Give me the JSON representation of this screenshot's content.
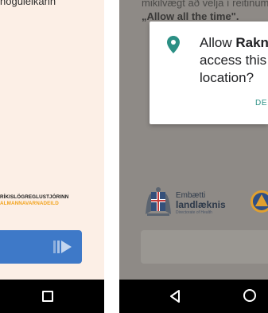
{
  "left_screen": {
    "top_text": "nóguleikann",
    "agency_line1": "RÍKISLÖGREGLUSTJÓRINN",
    "agency_line2": "ALMANNAVARNADEILD",
    "button_icon": "play-skip-icon"
  },
  "right_screen": {
    "top_text_line1": "mikilvægt að velja í reitinum",
    "top_text_line2": "„Allow all the time\".",
    "dialog": {
      "icon": "location-pin-icon",
      "allow_prefix": "Allow ",
      "app_name_partial": "Rakn",
      "line2": "access this",
      "line3": "location?",
      "deny_label": "DE"
    },
    "logo_landlaeknir": {
      "line1": "Embætti",
      "line2": "landlæknis",
      "line3": "Directorate of Health"
    },
    "logo_civil": "civil-protection-logo"
  },
  "navbar": {
    "back_icon": "back-triangle-icon",
    "home_icon": "home-circle-icon",
    "recents_icon": "recents-square-icon"
  },
  "colors": {
    "left_background": "#fcefe6",
    "button_blue": "#3e79c8",
    "agency_orange": "#f2a31b",
    "scrim_background": "#8e8a86",
    "pin_teal": "#2b8f84"
  }
}
